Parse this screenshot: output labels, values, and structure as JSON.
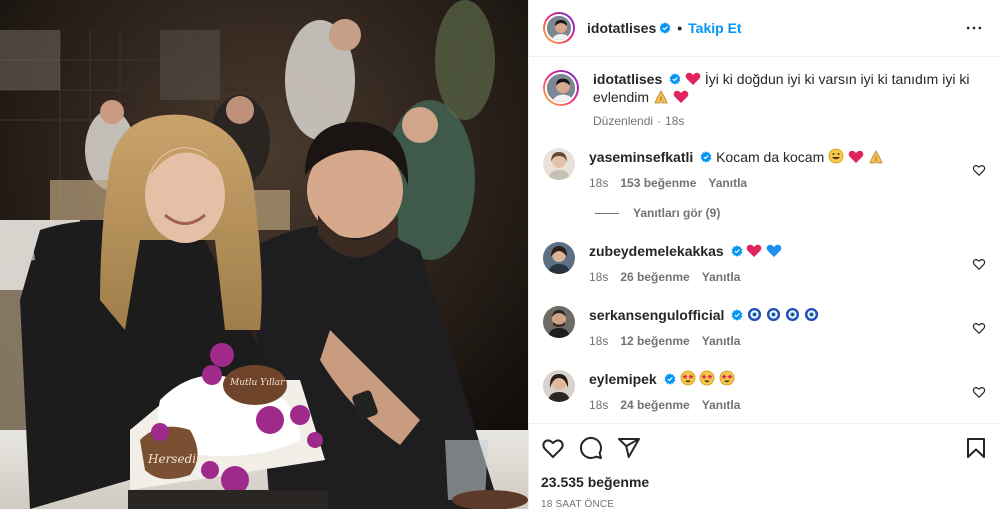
{
  "post": {
    "username": "idotatlises",
    "follow_label": "Takip Et",
    "dot": "•",
    "caption_text": "İyi ki doğdun iyi ki varsın iyi ki tanıdım iyi ki evlendim",
    "edited_label": "Düzenlendi",
    "edited_separator": "·",
    "edited_time": "18s",
    "likes": "23.535 beğenme",
    "time_ago": "18 SAAT ÖNCE"
  },
  "photo": {
    "cake_text_1": "Hersedim",
    "cake_text_2": "Mutlu Yıllar"
  },
  "comments": [
    {
      "username": "yaseminsefkatli",
      "verified": true,
      "text": "Kocam da kocam",
      "emojis": [
        "grinning-face",
        "red-heart",
        "folded-hands"
      ],
      "time": "18s",
      "likes": "153 beğenme",
      "reply": "Yanıtla",
      "view_replies": "Yanıtları gör (9)"
    },
    {
      "username": "zubeydemelekakkas",
      "verified": true,
      "text": "",
      "emojis": [
        "red-heart",
        "blue-heart"
      ],
      "time": "18s",
      "likes": "26 beğenme",
      "reply": "Yanıtla"
    },
    {
      "username": "serkansengulofficial",
      "verified": true,
      "text": "",
      "emojis": [
        "nazar-amulet",
        "nazar-amulet",
        "nazar-amulet",
        "nazar-amulet"
      ],
      "time": "18s",
      "likes": "12 beğenme",
      "reply": "Yanıtla"
    },
    {
      "username": "eylemipek",
      "verified": true,
      "text": "",
      "emojis": [
        "star-struck",
        "star-struck",
        "star-struck"
      ],
      "time": "18s",
      "likes": "24 beğenme",
      "reply": "Yanıtla"
    }
  ],
  "colors": {
    "accent_blue": "#0095f6",
    "text_primary": "#262626",
    "text_secondary": "#737373",
    "border": "#efefef"
  }
}
